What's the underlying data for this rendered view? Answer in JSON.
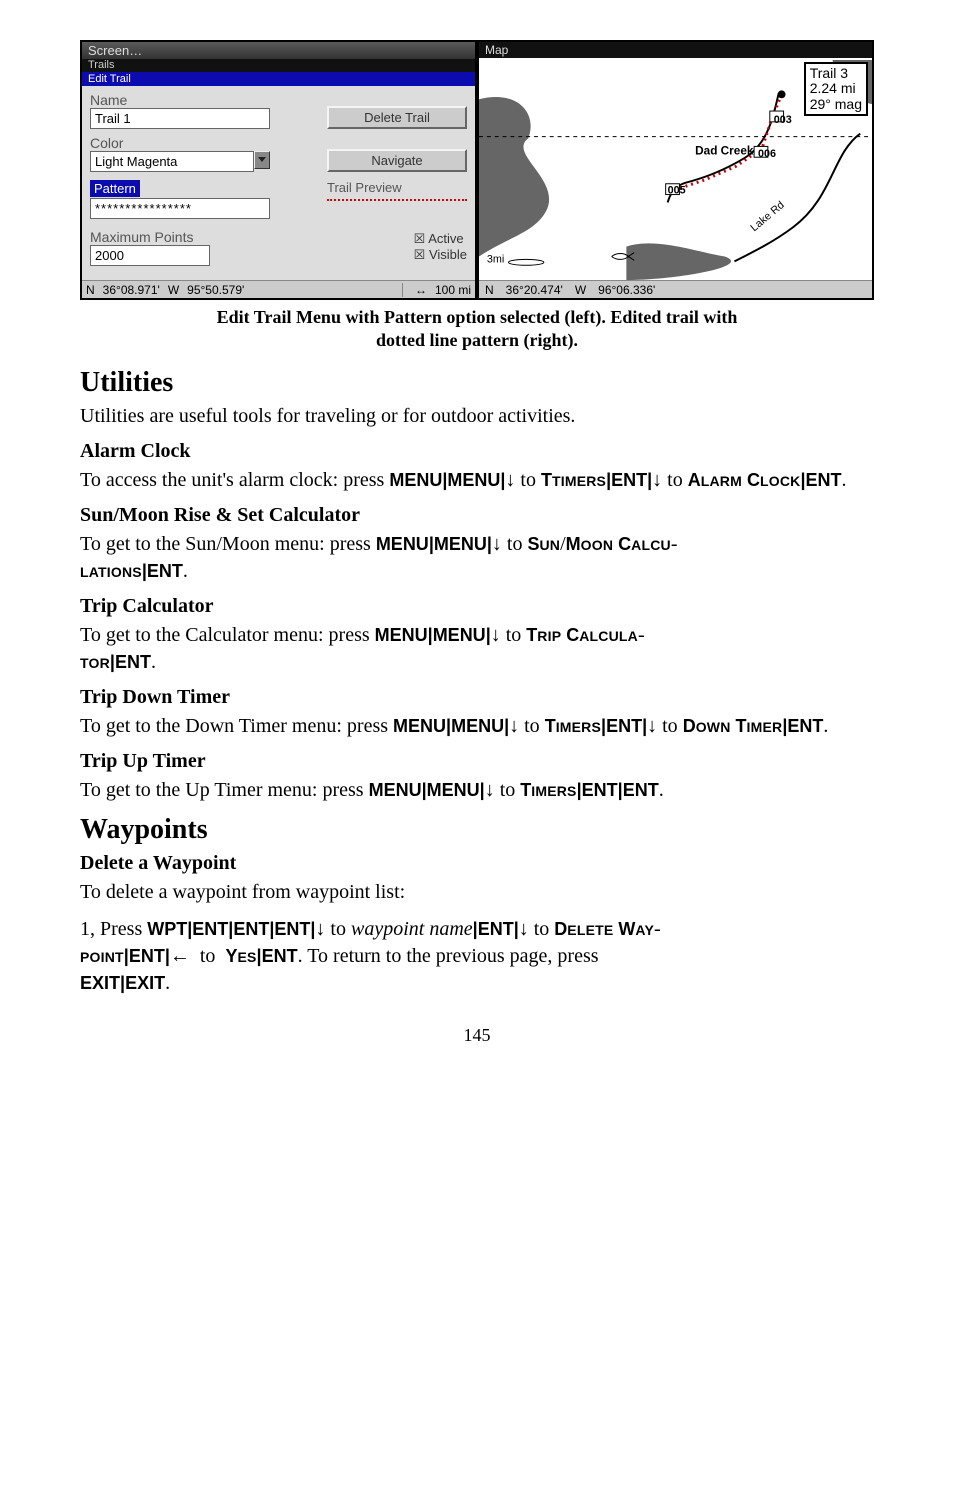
{
  "left_screenshot": {
    "title_outer": "Screen…",
    "title_dark": "Trails",
    "title_sel": "Edit Trail",
    "name_label": "Name",
    "name_value": "Trail 1",
    "delete_btn": "Delete Trail",
    "color_label": "Color",
    "color_value": "Light Magenta",
    "navigate_btn": "Navigate",
    "pattern_label": "Pattern",
    "pattern_value": "****************",
    "preview_label": "Trail Preview",
    "max_label": "Maximum Points",
    "max_value": "2000",
    "active_chk": "Active",
    "visible_chk": "Visible",
    "status_n": "N",
    "status_lat": "36°08.971'",
    "status_w": "W",
    "status_lon": "95°50.579'",
    "status_scale": "100 mi"
  },
  "right_screenshot": {
    "title": "Map",
    "info_1": "Trail 3",
    "info_2": "2.24 mi",
    "info_3": "29° mag",
    "lbl_dad": "Dad Creek",
    "lbl_003": "003",
    "lbl_006": "006",
    "lbl_005": "005",
    "lbl_lake": "Lake Rd",
    "scale": "3mi",
    "status_n": "N",
    "status_lat": "36°20.474'",
    "status_w": "W",
    "status_lon": "96°06.336'"
  },
  "caption_l1": "Edit Trail Menu with Pattern option selected (left). Edited trail with",
  "caption_l2": "dotted line pattern (right).",
  "utilities_h": "Utilities",
  "utilities_p": "Utilities are useful tools for traveling or for outdoor activities.",
  "alarm_h": "Alarm Clock",
  "alarm_pre": "To access the unit's alarm clock: press ",
  "kbd_menu": "MENU",
  "kbd_ent": "ENT",
  "to_word": " to ",
  "sc_timers": "TIMERS",
  "sc_alarm_pref": "A",
  "sc_alarm_rest": "LARM",
  "sc_clock_pref": "C",
  "sc_clock_rest": "LOCK",
  "sun_h": "Sun/Moon Rise & Set Calculator",
  "sun_pre": "To get to the Sun/Moon menu: press ",
  "sc_sun_pref": "S",
  "sc_sun_rest": "UN",
  "sc_moon_pref": "M",
  "sc_moon_rest": "OON",
  "sc_calcu_pref": "C",
  "sc_calcu_rest": "ALCU",
  "sc_lations": "LATIONS",
  "trip_h": "Trip Calculator",
  "trip_pre": "To get to the Calculator menu: press ",
  "sc_trip_pref": "T",
  "sc_trip_rest": "RIP",
  "sc_calca_pref": "C",
  "sc_calca_rest": "ALCULA",
  "sc_tor": "TOR",
  "down_h": "Trip Down Timer",
  "down_pre": "To get to the Down Timer menu: press ",
  "sc_down_pref": "D",
  "sc_down_rest": "OWN",
  "sc_timer_pref": "T",
  "sc_timer_rest": "IMER",
  "up_h": "Trip Up Timer",
  "up_pre": "To get to the Up Timer menu: press ",
  "wpt_h": "Waypoints",
  "del_h": "Delete a Waypoint",
  "del_p": "To delete a waypoint from waypoint list:",
  "step1_pre": "1, Press ",
  "kbd_wpt": "WPT",
  "wpt_name": "waypoint name",
  "sc_delete_pref": "D",
  "sc_delete_rest": "ELETE",
  "sc_way_pref": "W",
  "sc_way_rest": "AY",
  "sc_point": "POINT",
  "kbd_yes": "YES",
  "ret_text": ". To return to the previous page, press",
  "kbd_exit": "EXIT",
  "period": ".",
  "pipe": "|",
  "arrow_down": "↓",
  "arrow_left": "←",
  "page_num": "145"
}
